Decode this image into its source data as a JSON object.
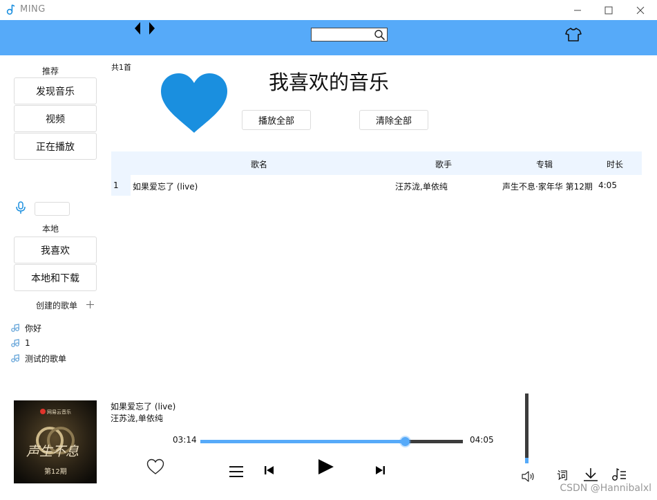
{
  "window": {
    "title": "MING"
  },
  "header": {
    "search": {
      "value": "",
      "placeholder": ""
    }
  },
  "sidebar": {
    "recommend_label": "推荐",
    "recommend_items": [
      "发现音乐",
      "视频",
      "正在播放"
    ],
    "mic_input": {
      "value": ""
    },
    "local_label": "本地",
    "local_items": [
      "我喜欢",
      "本地和下载"
    ],
    "created_label": "创建的歌单",
    "playlists": [
      "你好",
      "1",
      "测试的歌单"
    ]
  },
  "main": {
    "count_text": "共1首",
    "title": "我喜欢的音乐",
    "play_all": "播放全部",
    "clear_all": "清除全部",
    "columns": {
      "name": "歌名",
      "artist": "歌手",
      "album": "专辑",
      "duration": "时长"
    },
    "rows": [
      {
        "index": "1",
        "name": "如果爱忘了 (live)",
        "artist": "汪苏泷,单依纯",
        "album": "声生不息·家年华 第12期",
        "duration": "4:05"
      }
    ]
  },
  "player": {
    "song": "如果爱忘了 (live)",
    "artist": "汪苏泷,单依纯",
    "current_time": "03:14",
    "total_time": "04:05",
    "progress": 0.78,
    "volume": 0.08,
    "lyric_label": "词",
    "cover": {
      "brand": "网易云音乐",
      "show": "声生不息",
      "episode": "第12期"
    }
  },
  "colors": {
    "accent": "#56aaf9",
    "header_bg": "#56aaf9",
    "table_header_bg": "#edf5ff",
    "heart": "#1a8fdf"
  },
  "watermark": "CSDN @Hannibalxl"
}
